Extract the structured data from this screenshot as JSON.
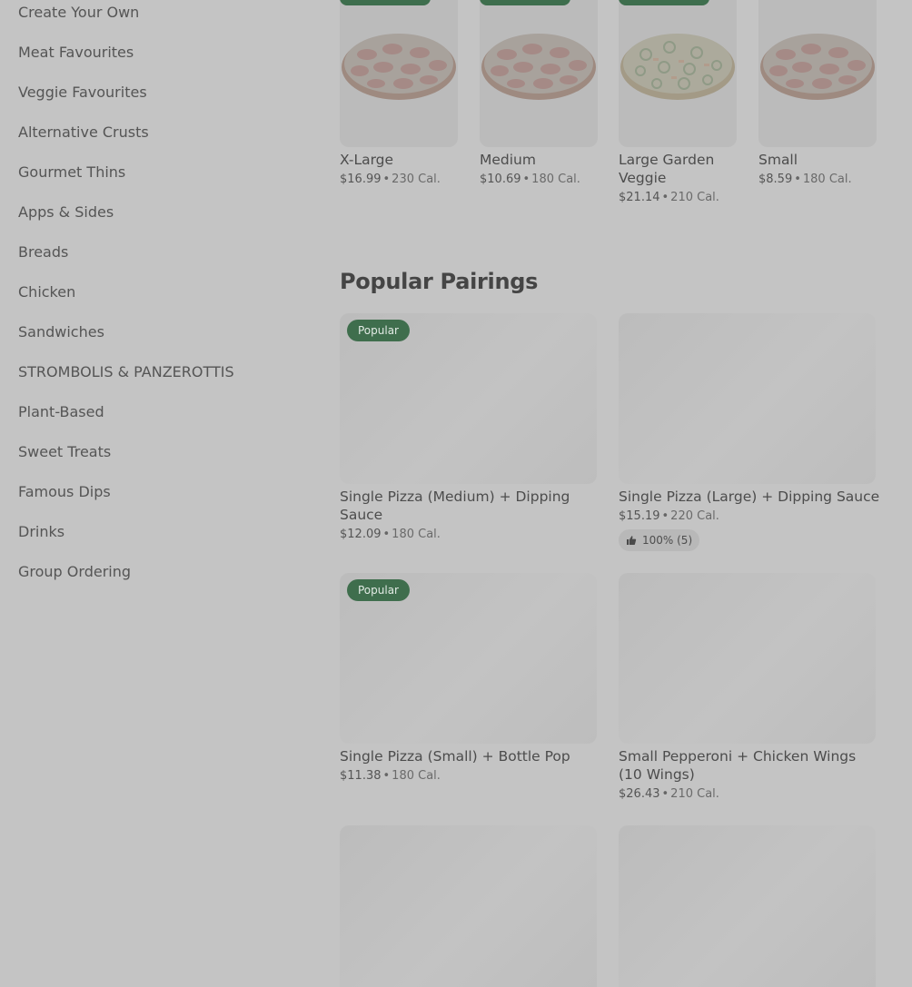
{
  "sidebar": {
    "items": [
      {
        "label": "Create Your Own"
      },
      {
        "label": "Meat Favourites"
      },
      {
        "label": "Veggie Favourites"
      },
      {
        "label": "Alternative Crusts"
      },
      {
        "label": "Gourmet Thins"
      },
      {
        "label": "Apps & Sides"
      },
      {
        "label": "Breads"
      },
      {
        "label": "Chicken"
      },
      {
        "label": "Sandwiches"
      },
      {
        "label": "STROMBOLIS & PANZEROTTIS"
      },
      {
        "label": "Plant-Based"
      },
      {
        "label": "Sweet Treats"
      },
      {
        "label": "Famous Dips"
      },
      {
        "label": "Drinks"
      },
      {
        "label": "Group Ordering"
      }
    ]
  },
  "top_products": [
    {
      "name": "X-Large",
      "price": "$16.99",
      "calories": "230 Cal."
    },
    {
      "name": "Medium",
      "price": "$10.69",
      "calories": "180 Cal."
    },
    {
      "name": "Large Garden Veggie",
      "price": "$21.14",
      "calories": "210 Cal."
    },
    {
      "name": "Small",
      "price": "$8.59",
      "calories": "180 Cal."
    }
  ],
  "pairings": {
    "title": "Popular Pairings",
    "items": [
      {
        "name": "Single Pizza (Medium) + Dipping Sauce",
        "price": "$12.09",
        "calories": "180 Cal.",
        "badge": "Popular"
      },
      {
        "name": "Single Pizza (Large) + Dipping Sauce",
        "price": "$15.19",
        "calories": "220 Cal.",
        "rating": "100% (5)"
      },
      {
        "name": "Single Pizza (Small) + Bottle Pop",
        "price": "$11.38",
        "calories": "180 Cal.",
        "badge": "Popular"
      },
      {
        "name": "Small Pepperoni + Chicken Wings (10 Wings)",
        "price": "$26.43",
        "calories": "210 Cal."
      }
    ]
  },
  "separator": "•",
  "colors": {
    "badge": "#3f6e4d",
    "overlay_bg": "#c4c4c4"
  }
}
